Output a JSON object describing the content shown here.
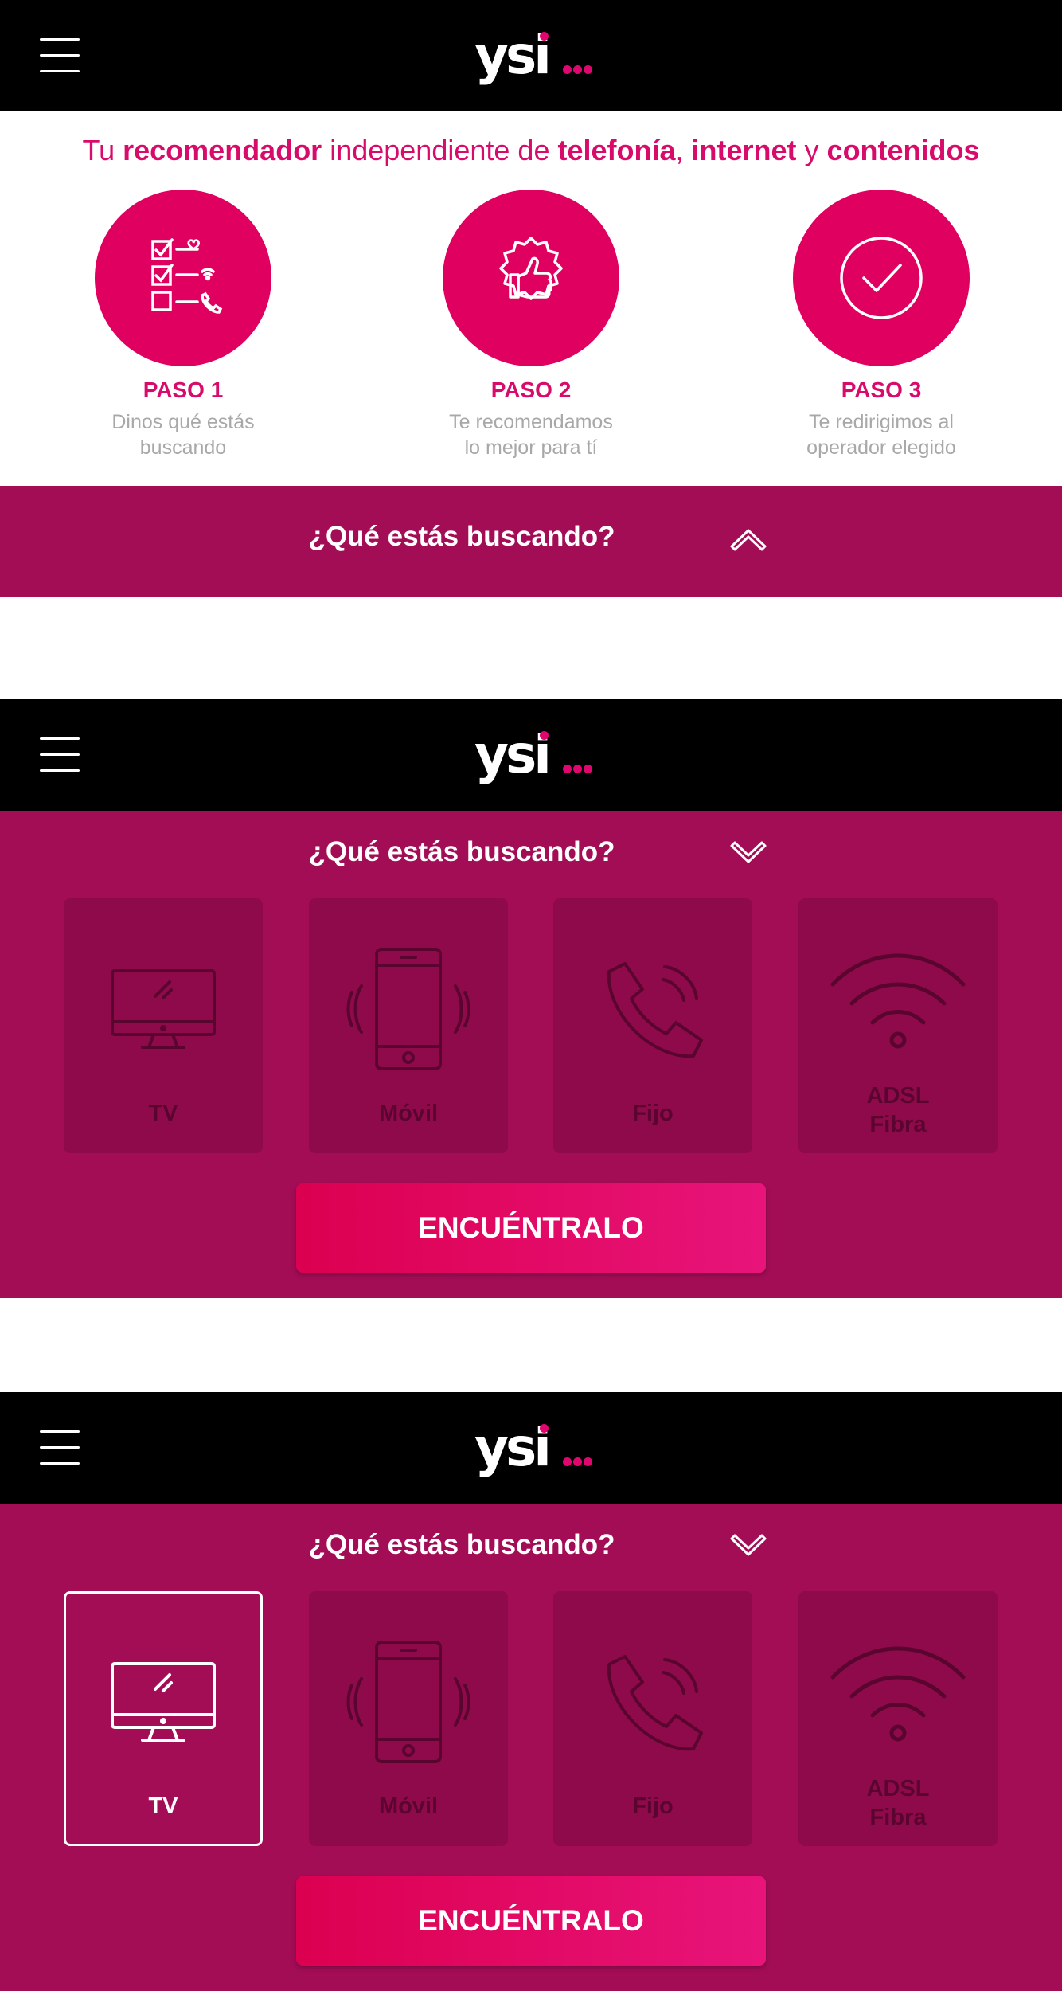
{
  "brand": {
    "logo_text": "ysi",
    "accent_color": "#e0005f",
    "band_color": "#a30d56",
    "header_color": "#000000"
  },
  "tagline": {
    "parts": [
      "Tu ",
      "recomendador",
      " independiente de ",
      "telefonía",
      ", ",
      "internet",
      " y ",
      "contenidos"
    ]
  },
  "steps": [
    {
      "title": "PASO 1",
      "line1": "Dinos qué estás",
      "line2": "buscando",
      "icon": "checklist-icon"
    },
    {
      "title": "PASO 2",
      "line1": "Te recomendamos",
      "line2": "lo mejor para tí",
      "icon": "thumbs-up-icon"
    },
    {
      "title": "PASO 3",
      "line1": "Te redirigimos al",
      "line2": "operador elegido",
      "icon": "check-circle-icon"
    }
  ],
  "search": {
    "title": "¿Qué estás buscando?",
    "cta_label": "ENCUÉNTRALO",
    "options": [
      {
        "label": "TV",
        "icon": "tv-icon"
      },
      {
        "label": "Móvil",
        "icon": "mobile-phone-icon"
      },
      {
        "label": "Fijo",
        "icon": "landline-phone-icon"
      },
      {
        "label_line1": "ADSL",
        "label_line2": "Fibra",
        "icon": "wifi-icon"
      }
    ],
    "selected_in_state3": "TV"
  }
}
